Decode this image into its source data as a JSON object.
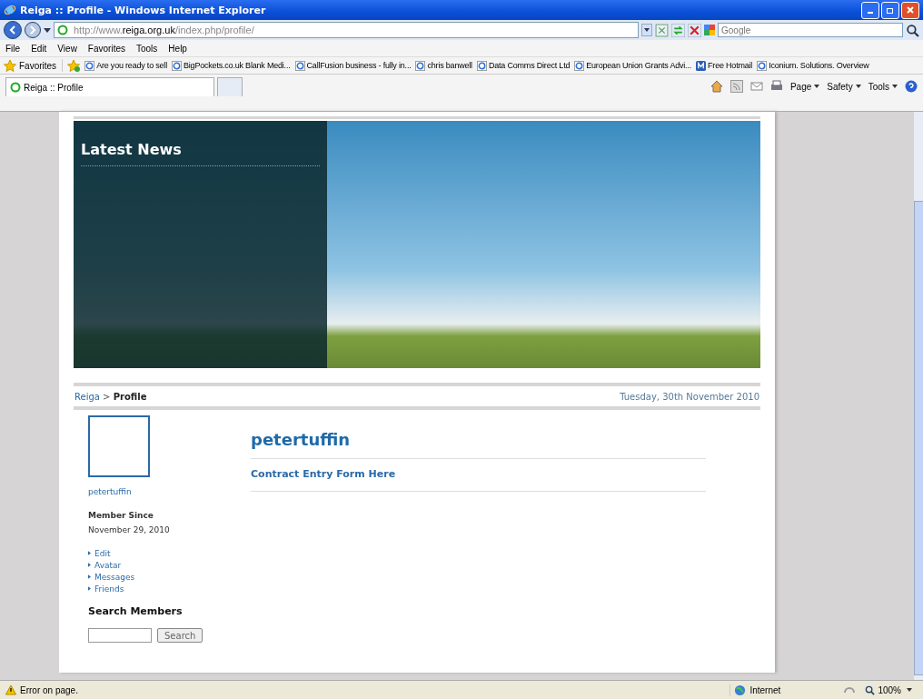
{
  "window": {
    "title": "Reiga :: Profile - Windows Internet Explorer"
  },
  "address": {
    "url": "http://www.**reiga.org.uk**/index.php/profile/"
  },
  "search": {
    "placeholder": "Google"
  },
  "menu": [
    "File",
    "Edit",
    "View",
    "Favorites",
    "Tools",
    "Help"
  ],
  "favorites": {
    "label": "Favorites",
    "items": [
      {
        "label": "Are you ready to sell",
        "kind": "page"
      },
      {
        "label": "BigPockets.co.uk Blank Medi...",
        "kind": "page"
      },
      {
        "label": "CallFusion business - fully in...",
        "kind": "page"
      },
      {
        "label": "chris banwell",
        "kind": "page"
      },
      {
        "label": "Data Comms Direct Ltd",
        "kind": "page"
      },
      {
        "label": "European Union Grants Advi...",
        "kind": "page"
      },
      {
        "label": "Free Hotmail",
        "kind": "mail"
      },
      {
        "label": "Iconium. Solutions. Overview",
        "kind": "page"
      }
    ]
  },
  "tabs": [
    {
      "label": "Reiga :: Profile",
      "selected": true
    }
  ],
  "commands": [
    "Page",
    "Safety",
    "Tools"
  ],
  "banner": {
    "heading": "Latest News"
  },
  "breadcrumb": {
    "link": "Reiga",
    "separator": ">",
    "current": "Profile"
  },
  "date": "Tuesday, 30th November 2010",
  "sidebar": {
    "username": "petertuffin",
    "member_since_label": "Member Since",
    "member_since": "November 29, 2010",
    "links": [
      "Edit",
      "Avatar",
      "Messages",
      "Friends"
    ],
    "search_heading": "Search Members",
    "search_button": "Search"
  },
  "main": {
    "title": "petertuffin",
    "link": "Contract Entry Form Here"
  },
  "status_bar": {
    "message": "Error on page.",
    "zone": "Internet",
    "zoom": "100%"
  }
}
